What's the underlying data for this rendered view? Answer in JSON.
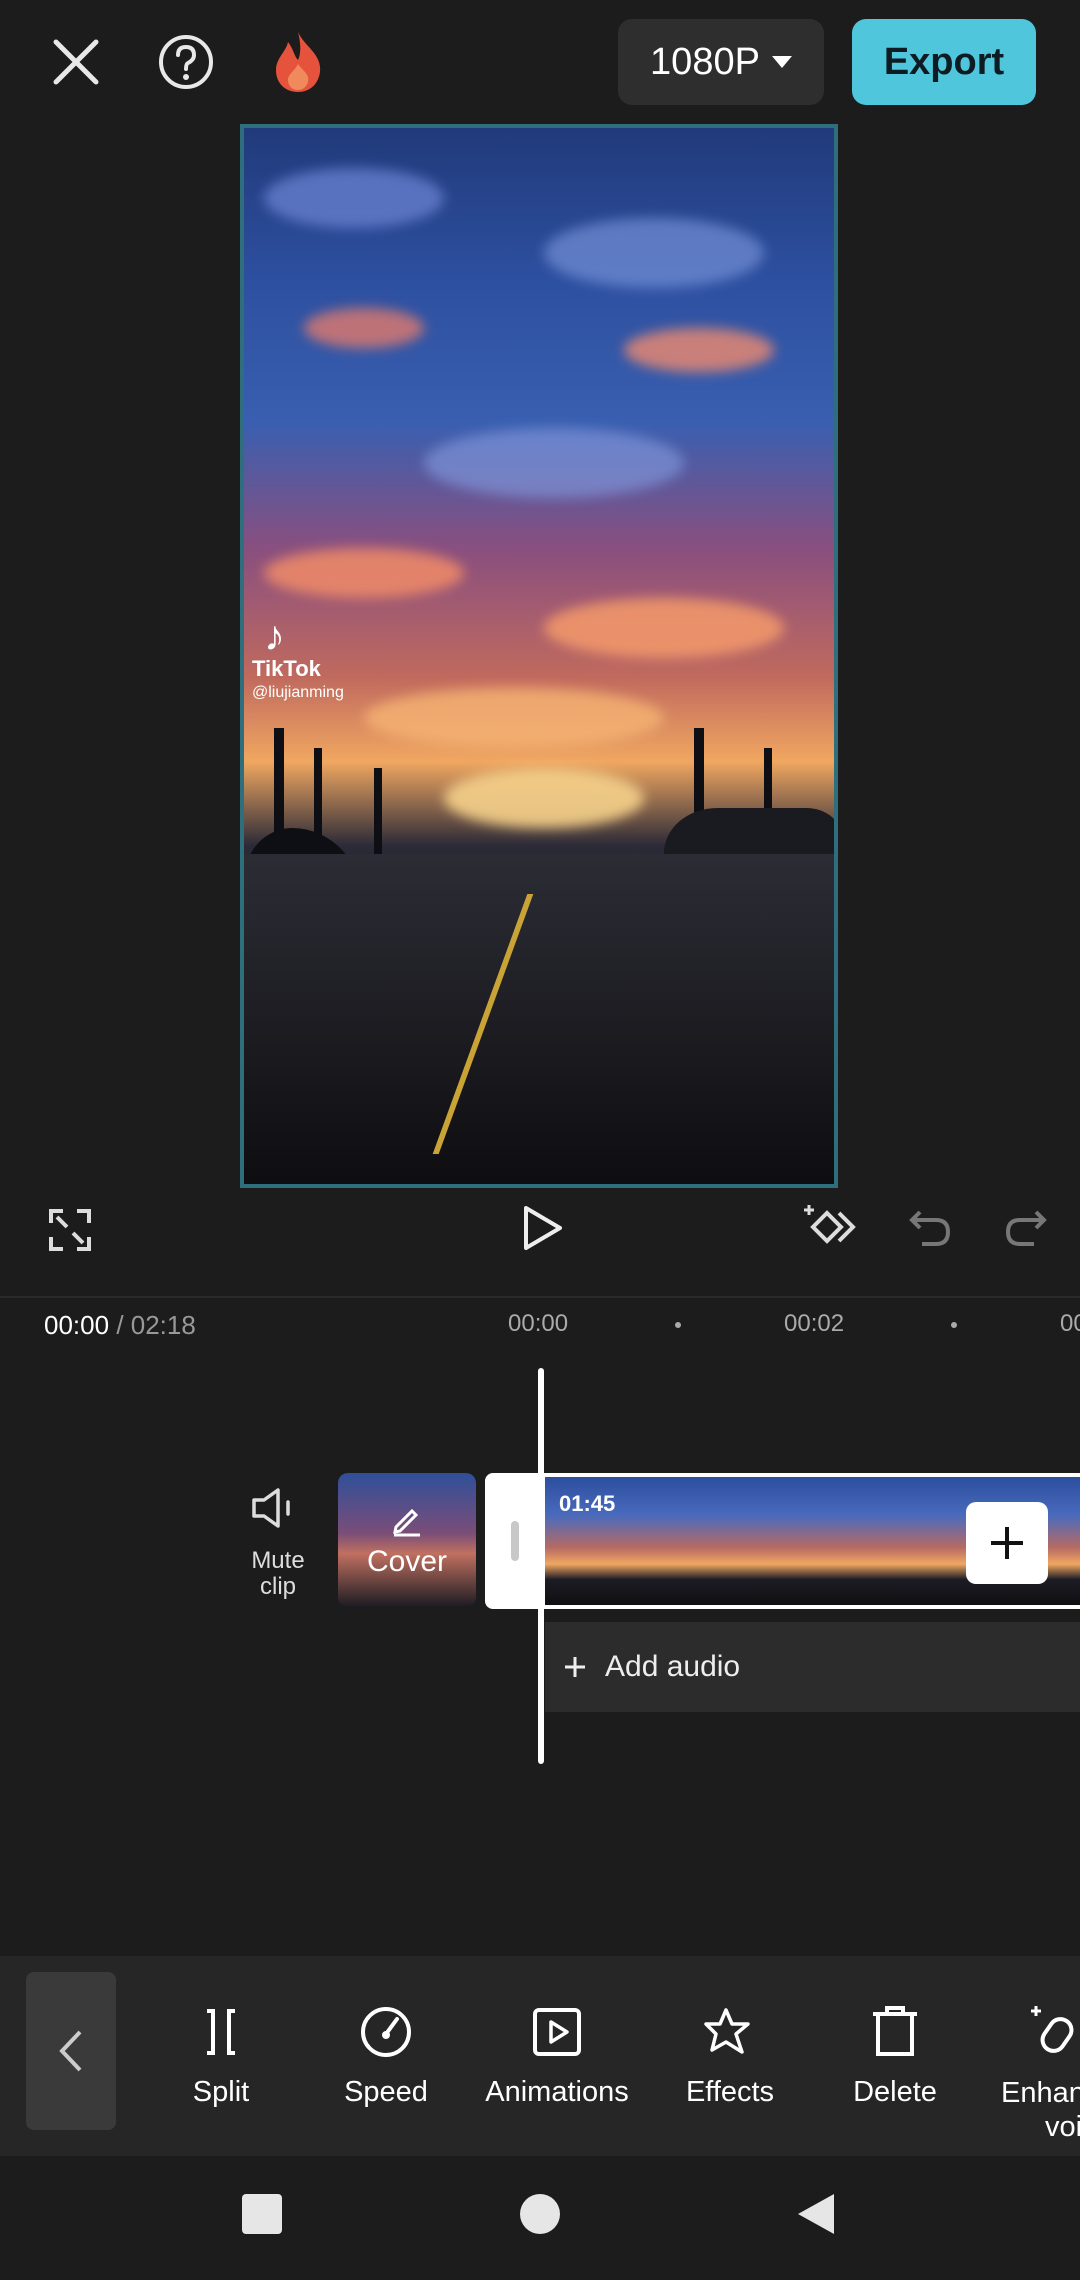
{
  "topbar": {
    "resolution": "1080P",
    "export_label": "Export"
  },
  "preview": {
    "watermark_brand": "TikTok",
    "watermark_user": "@liujianming"
  },
  "timeline": {
    "current_time": "00:00",
    "total_time": "/ 02:18",
    "ruler": [
      "00:00",
      "00:02",
      "00"
    ],
    "mute_label_1": "Mute",
    "mute_label_2": "clip",
    "cover_label": "Cover",
    "clip_duration": "01:45",
    "add_audio_label": "Add audio"
  },
  "toolbar": {
    "items": [
      {
        "label": "Split",
        "icon": "split-icon"
      },
      {
        "label": "Speed",
        "icon": "speed-icon"
      },
      {
        "label": "Animations",
        "icon": "animations-icon"
      },
      {
        "label": "Effects",
        "icon": "effects-icon"
      },
      {
        "label": "Delete",
        "icon": "delete-icon"
      },
      {
        "label": "Enhance voice",
        "label_line1": "Enhan",
        "label_line2": "voic",
        "icon": "enhance-voice-icon"
      }
    ]
  },
  "colors": {
    "background": "#1c1c1c",
    "accent": "#4fc6dc",
    "toolbar": "#262626"
  }
}
